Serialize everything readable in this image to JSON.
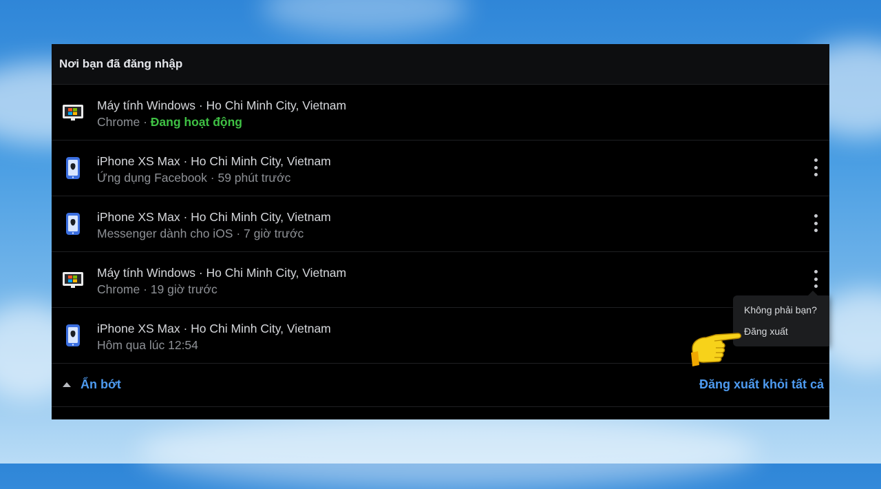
{
  "panel": {
    "title": "Nơi bạn đã đăng nhập"
  },
  "sessions": [
    {
      "device": "Máy tính Windows · Ho Chi Minh City, Vietnam",
      "app": "Chrome · ",
      "status": "Đang hoạt động",
      "icon": "windows-computer-icon"
    },
    {
      "device": "iPhone XS Max · Ho Chi Minh City, Vietnam",
      "app": "Ứng dụng Facebook · 59 phút trước",
      "icon": "iphone-icon"
    },
    {
      "device": "iPhone XS Max · Ho Chi Minh City, Vietnam",
      "app": "Messenger dành cho iOS · 7 giờ trước",
      "icon": "iphone-icon"
    },
    {
      "device": "Máy tính Windows · Ho Chi Minh City, Vietnam",
      "app": "Chrome · 19 giờ trước",
      "icon": "windows-computer-icon"
    },
    {
      "device": "iPhone XS Max · Ho Chi Minh City, Vietnam",
      "app": "Hôm qua lúc 12:54",
      "icon": "iphone-icon"
    }
  ],
  "footer": {
    "collapse_label": "Ẩn bớt",
    "logout_all_label": "Đăng xuất khỏi tất cả"
  },
  "popup": {
    "not_you_label": "Không phải bạn?",
    "logout_label": "Đăng xuất"
  },
  "colors": {
    "accent": "#4e9bf0",
    "active": "#3fc144",
    "background": "#000000"
  }
}
